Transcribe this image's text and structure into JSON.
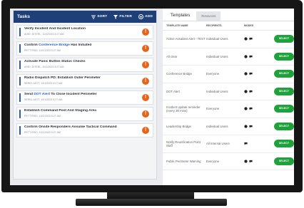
{
  "tasks_panel": {
    "title": "Tasks",
    "sort_label": "SORT",
    "filter_label": "FILTER",
    "add_label": "ADD",
    "alert_glyph": "!",
    "items": [
      {
        "title": "Verify Incident And Incident Location",
        "meta": "AHID: DITERL, 10/1/2023 5:27 AM"
      },
      {
        "title_pre": "Confirm ",
        "title_hl": "Conference Bridge",
        "title_post": " Has Initiated",
        "meta": "PETT RSID, 10/1/2023 5:27 AM"
      },
      {
        "title": "Activate Panic Button Status Checks",
        "meta": "AHID: DITERL, 10/1/2023 5:27 AM"
      },
      {
        "title": "Radio Dispatch PD: Establish Outer Perimeter",
        "meta": "SEREL ASTT, 10/1/2023 5:27 AM"
      },
      {
        "title_pre": "Send ",
        "title_hl": "DOT Alert",
        "title_post": " To Close Incident Perimeter",
        "meta": "SEREL ASTT, 10/1/2023 5:27 AM"
      },
      {
        "title": "Establish Command Post And Staging Area",
        "meta": "PETT RSID, 10/1/2023 5:27 AM"
      },
      {
        "title": "Confirm Onsite Responders Assume Tactical Command",
        "meta": "PETT RSID, 10/1/2023 5:27 AM"
      }
    ]
  },
  "templates_panel": {
    "tabs": [
      {
        "label": "Templates",
        "active": true
      },
      {
        "label": "Resources",
        "active": false
      }
    ],
    "columns": {
      "name": "TEMPLATE NAME",
      "recipients": "RECIPIENTS",
      "modes": "MODES"
    },
    "select_label": "SELECT",
    "rows": [
      {
        "name": "Active Assailant Alert - TEST",
        "recipients": "Individual Users",
        "modes": [
          "email-icon",
          "chat-icon"
        ]
      },
      {
        "name": "All clear",
        "recipients": "Individual Users",
        "modes": [
          "email-icon",
          "chat-icon"
        ]
      },
      {
        "name": "Conference Bridge",
        "recipients": "Everyone",
        "modes": [
          "email-icon",
          "chat-icon"
        ]
      },
      {
        "name": "DOT Alert",
        "recipients": "Individual Users",
        "modes": [
          "email-icon",
          "chat-icon"
        ]
      },
      {
        "name": "Incident update reminder (every 30 mins)",
        "recipients": "Everyone",
        "modes": [
          "email-icon",
          "chat-icon"
        ]
      },
      {
        "name": "Leadership Bridge",
        "recipients": "Individual Users",
        "modes": [
          "email-icon",
          "chat-icon"
        ]
      },
      {
        "name": "Notify Reunification Point Staff",
        "recipients": "All Internal Users",
        "modes": [
          "chat-icon"
        ]
      },
      {
        "name": "Public Perimeter Warning",
        "recipients": "Everyone",
        "modes": [
          "email-icon",
          "chat-icon"
        ]
      }
    ]
  },
  "colors": {
    "header_blue": "#1f3f78",
    "alert_orange": "#e8631a",
    "select_green": "#1fa23c",
    "highlight_blue": "#2b65c8"
  }
}
